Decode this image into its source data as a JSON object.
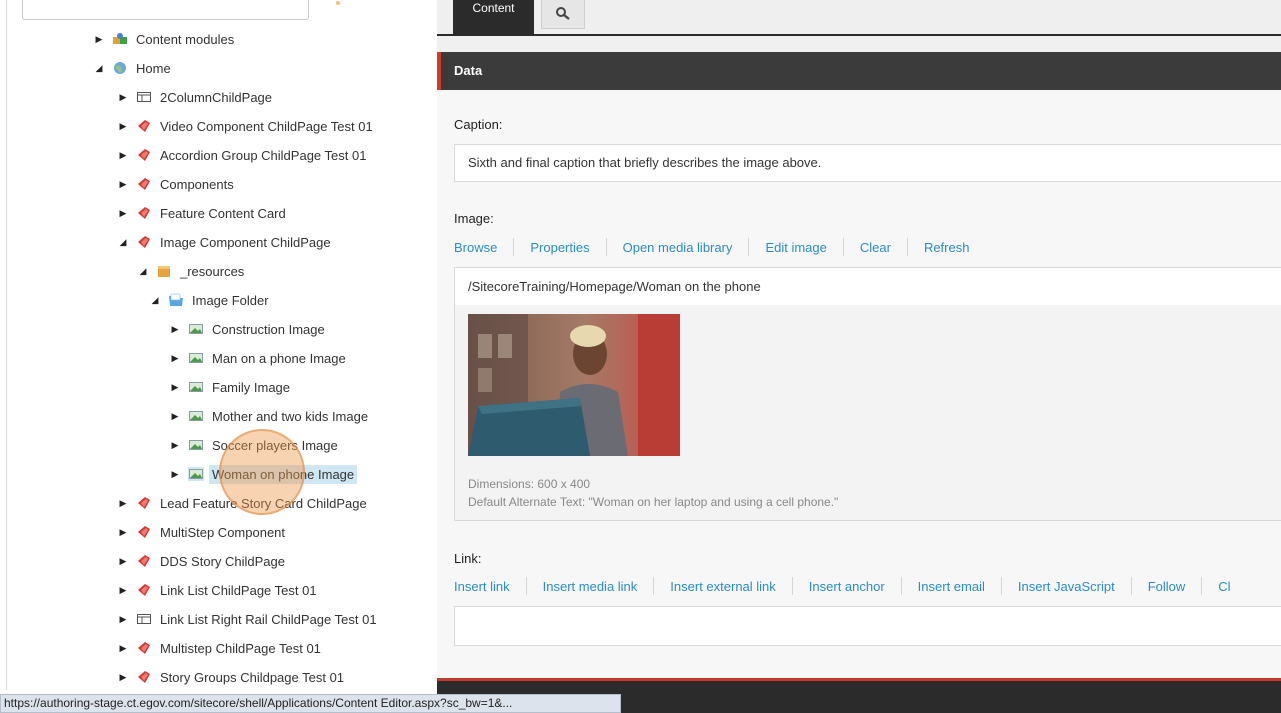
{
  "tree": {
    "items": [
      {
        "label": "Content modules",
        "icon": "puzzle-icon",
        "expanded": false
      },
      {
        "label": "Home",
        "icon": "globe-icon",
        "expanded": true
      },
      {
        "label": "2ColumnChildPage",
        "icon": "layout-icon",
        "expanded": false
      },
      {
        "label": "Video Component ChildPage Test 01",
        "icon": "red-item-icon",
        "expanded": false
      },
      {
        "label": "Accordion Group ChildPage Test 01",
        "icon": "red-item-icon",
        "expanded": false
      },
      {
        "label": "Components",
        "icon": "red-item-icon",
        "expanded": false
      },
      {
        "label": "Feature Content Card",
        "icon": "red-item-icon",
        "expanded": false
      },
      {
        "label": "Image Component ChildPage",
        "icon": "red-item-icon",
        "expanded": true
      },
      {
        "label": "_resources",
        "icon": "box-icon",
        "expanded": true
      },
      {
        "label": "Image Folder",
        "icon": "folder-icon",
        "expanded": true
      },
      {
        "label": "Construction Image",
        "icon": "image-icon",
        "expanded": false
      },
      {
        "label": "Man on a phone Image",
        "icon": "image-icon",
        "expanded": false
      },
      {
        "label": "Family Image",
        "icon": "image-icon",
        "expanded": false
      },
      {
        "label": "Mother and two kids Image",
        "icon": "image-icon",
        "expanded": false
      },
      {
        "label": "Soccer players Image",
        "icon": "image-icon",
        "expanded": false
      },
      {
        "label": "Woman on phone Image",
        "icon": "image-icon",
        "expanded": false,
        "selected": true
      },
      {
        "label": "Lead Feature Story Card ChildPage",
        "icon": "red-item-icon",
        "expanded": false
      },
      {
        "label": "MultiStep Component",
        "icon": "red-item-icon",
        "expanded": false
      },
      {
        "label": "DDS Story ChildPage",
        "icon": "red-item-icon",
        "expanded": false
      },
      {
        "label": "Link List ChildPage Test 01",
        "icon": "red-item-icon",
        "expanded": false
      },
      {
        "label": "Link List Right Rail ChildPage Test 01",
        "icon": "layout-icon",
        "expanded": false
      },
      {
        "label": "Multistep ChildPage Test 01",
        "icon": "red-item-icon",
        "expanded": false
      },
      {
        "label": "Story Groups Childpage Test 01",
        "icon": "red-item-icon",
        "expanded": false
      }
    ]
  },
  "tabs": {
    "content_label": "Content",
    "search_icon": "search-icon"
  },
  "section": {
    "title": "Data"
  },
  "caption": {
    "label": "Caption:",
    "value": "Sixth and final caption that briefly describes the image above."
  },
  "image": {
    "label": "Image:",
    "actions": [
      "Browse",
      "Properties",
      "Open media library",
      "Edit image",
      "Clear",
      "Refresh"
    ],
    "path": "/SitecoreTraining/Homepage/Woman on the phone",
    "dimensions": "Dimensions: 600 x 400",
    "alt_text": "Default Alternate Text: \"Woman on her laptop and using a cell phone.\""
  },
  "link": {
    "label": "Link:",
    "actions": [
      "Insert link",
      "Insert media link",
      "Insert external link",
      "Insert anchor",
      "Insert email",
      "Insert JavaScript",
      "Follow",
      "Cl"
    ],
    "value": ""
  },
  "status_bar": {
    "url": "https://authoring-stage.ct.egov.com/sitecore/shell/Applications/Content Editor.aspx?sc_bw=1&..."
  },
  "colors": {
    "link": "#2a8cc8",
    "header_bg": "#3b3b3b",
    "accent_red": "#d13b2a",
    "selected_bg": "#cfe6f3"
  }
}
